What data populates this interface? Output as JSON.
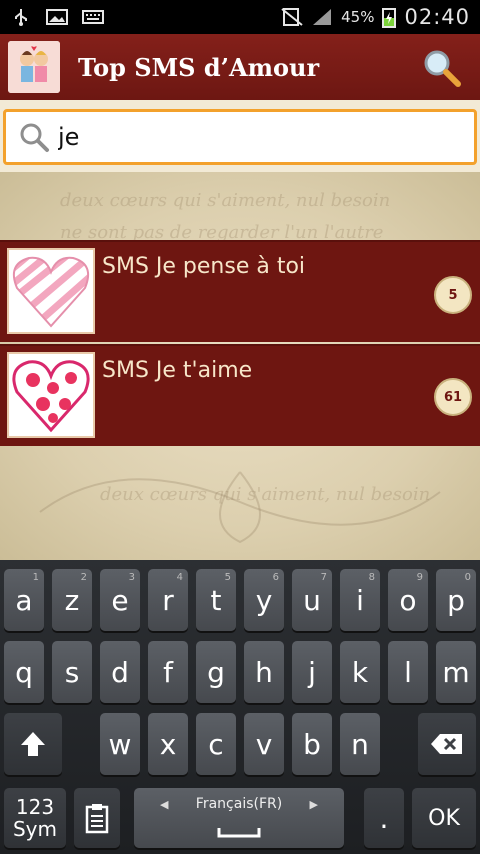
{
  "status_bar": {
    "battery": "45%",
    "time": "02:40"
  },
  "action_bar": {
    "title": "Top SMS d’Amour"
  },
  "search": {
    "value": "je",
    "placeholder": ""
  },
  "background_text": [
    "deux cœurs qui s'aiment, nul besoin",
    "ne sont pas de regarder l'un l'autre",
    "deux cœurs qui s'aiment, nul besoin"
  ],
  "list": {
    "items": [
      {
        "title": "SMS Je pense à toi",
        "count": "5"
      },
      {
        "title": "SMS Je t'aime",
        "count": "61"
      }
    ]
  },
  "keyboard": {
    "row1": [
      {
        "key": "a",
        "hint": "1"
      },
      {
        "key": "z",
        "hint": "2"
      },
      {
        "key": "e",
        "hint": "3"
      },
      {
        "key": "r",
        "hint": "4"
      },
      {
        "key": "t",
        "hint": "5"
      },
      {
        "key": "y",
        "hint": "6"
      },
      {
        "key": "u",
        "hint": "7"
      },
      {
        "key": "i",
        "hint": "8"
      },
      {
        "key": "o",
        "hint": "9"
      },
      {
        "key": "p",
        "hint": "0"
      }
    ],
    "row2": [
      "q",
      "s",
      "d",
      "f",
      "g",
      "h",
      "j",
      "k",
      "l",
      "m"
    ],
    "row3": [
      "w",
      "x",
      "c",
      "v",
      "b",
      "n"
    ],
    "sym_line1": "123",
    "sym_line2": "Sym",
    "language": "Français(FR)",
    "period": ".",
    "ok": "OK"
  },
  "colors": {
    "accent": "#6e1611",
    "search_border": "#f3a12c"
  }
}
